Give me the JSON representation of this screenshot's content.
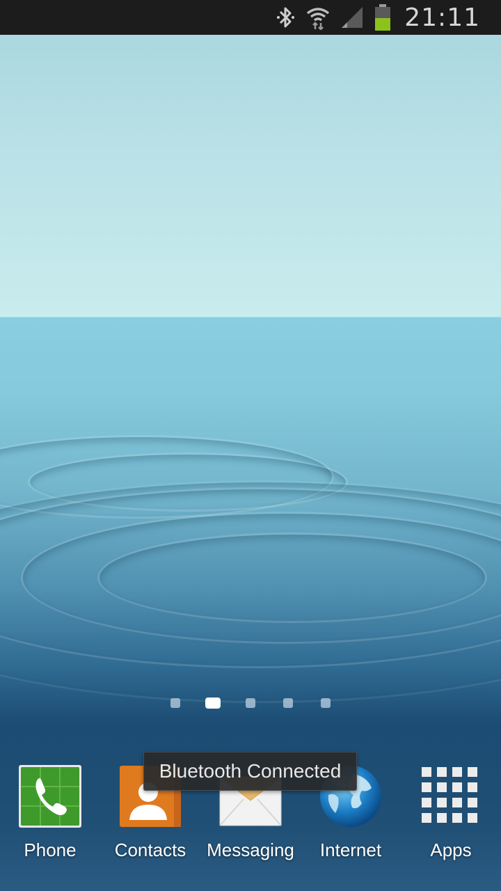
{
  "status_bar": {
    "time": "21:11",
    "icons": [
      "bluetooth-icon",
      "wifi-icon",
      "signal-icon",
      "battery-icon"
    ],
    "battery_color": "#8cc21e"
  },
  "page_indicator": {
    "count": 5,
    "active_index": 1
  },
  "dock": {
    "items": [
      {
        "label": "Phone",
        "icon": "phone-icon"
      },
      {
        "label": "Contacts",
        "icon": "contacts-icon"
      },
      {
        "label": "Messaging",
        "icon": "messaging-icon"
      },
      {
        "label": "Internet",
        "icon": "internet-globe-icon"
      },
      {
        "label": "Apps",
        "icon": "apps-grid-icon"
      }
    ]
  },
  "toast": {
    "message": "Bluetooth Connected"
  }
}
